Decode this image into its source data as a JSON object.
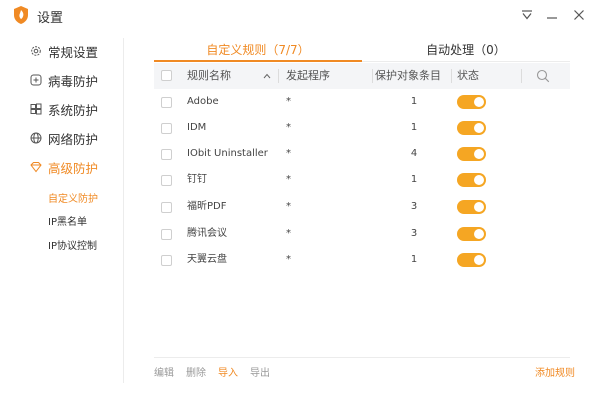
{
  "window": {
    "title": "设置",
    "accent_color": "#f08a24",
    "toggle_color": "#f5a623"
  },
  "sidebar": {
    "items": [
      {
        "label": "常规设置",
        "icon": "gear-icon"
      },
      {
        "label": "病毒防护",
        "icon": "plus-square-icon"
      },
      {
        "label": "系统防护",
        "icon": "windows-icon"
      },
      {
        "label": "网络防护",
        "icon": "globe-icon"
      },
      {
        "label": "高级防护",
        "icon": "diamond-icon"
      }
    ],
    "sub_items": [
      {
        "label": "自定义防护"
      },
      {
        "label": "IP黑名单"
      },
      {
        "label": "IP协议控制"
      }
    ]
  },
  "tabs": {
    "custom": "自定义规则（7/7）",
    "auto": "自动处理（0）"
  },
  "table": {
    "headers": {
      "name": "规则名称",
      "program": "发起程序",
      "count": "保护对象条目",
      "status": "状态"
    },
    "rows": [
      {
        "name": "Adobe",
        "program": "*",
        "count": "1",
        "enabled": true
      },
      {
        "name": "IDM",
        "program": "*",
        "count": "1",
        "enabled": true
      },
      {
        "name": "IObit Uninstaller",
        "program": "*",
        "count": "4",
        "enabled": true
      },
      {
        "name": "钉钉",
        "program": "*",
        "count": "1",
        "enabled": true
      },
      {
        "name": "福昕PDF",
        "program": "*",
        "count": "3",
        "enabled": true
      },
      {
        "name": "腾讯会议",
        "program": "*",
        "count": "3",
        "enabled": true
      },
      {
        "name": "天翼云盘",
        "program": "*",
        "count": "1",
        "enabled": true
      }
    ]
  },
  "footer": {
    "edit": "编辑",
    "delete": "删除",
    "import": "导入",
    "export": "导出",
    "add_rule": "添加规则"
  }
}
